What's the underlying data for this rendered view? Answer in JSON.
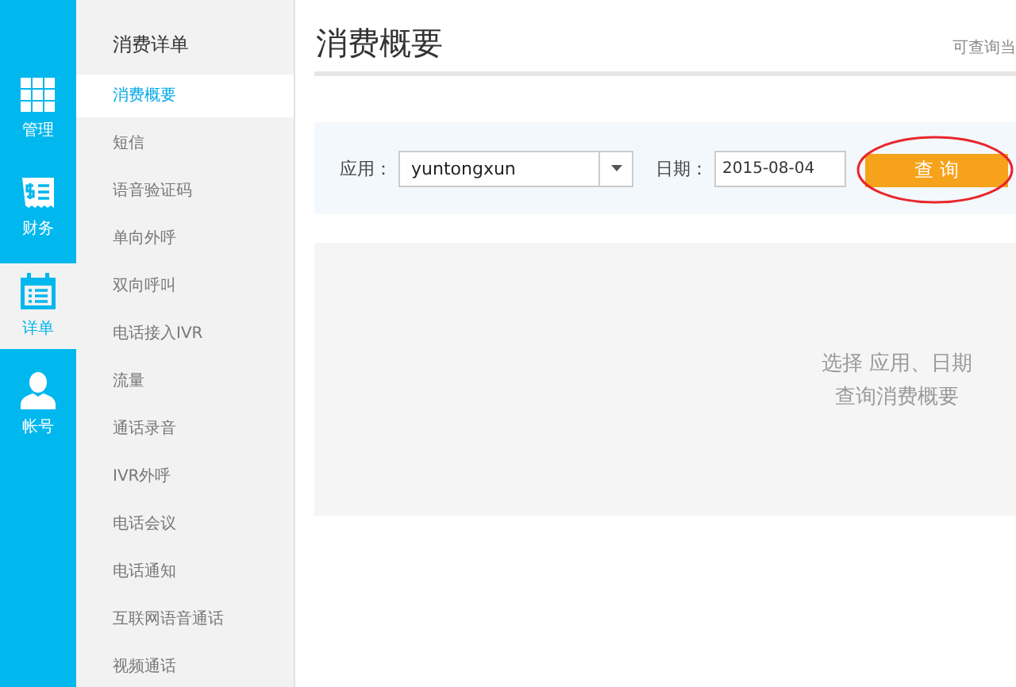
{
  "rail": [
    {
      "label": "管理",
      "kind": "grid",
      "selected": false
    },
    {
      "label": "财务",
      "kind": "bill",
      "selected": false
    },
    {
      "label": "详单",
      "kind": "calendar",
      "selected": true
    },
    {
      "label": "帐号",
      "kind": "user",
      "selected": false
    }
  ],
  "sidebar": {
    "title": "消费详单",
    "items": [
      {
        "label": "消费概要",
        "selected": true
      },
      {
        "label": "短信",
        "selected": false
      },
      {
        "label": "语音验证码",
        "selected": false
      },
      {
        "label": "单向外呼",
        "selected": false
      },
      {
        "label": "双向呼叫",
        "selected": false
      },
      {
        "label": "电话接入IVR",
        "selected": false
      },
      {
        "label": "流量",
        "selected": false
      },
      {
        "label": "通话录音",
        "selected": false
      },
      {
        "label": "IVR外呼",
        "selected": false
      },
      {
        "label": "电话会议",
        "selected": false
      },
      {
        "label": "电话通知",
        "selected": false
      },
      {
        "label": "互联网语音通话",
        "selected": false
      },
      {
        "label": "视频通话",
        "selected": false
      }
    ]
  },
  "page": {
    "title": "消费概要",
    "note": "可查询当"
  },
  "filter": {
    "app_label": "应用：",
    "app_value": "yuntongxun",
    "date_label": "日期：",
    "date_value": "2015-08-04",
    "query_button": "查 询",
    "button_circled": true
  },
  "empty_state": {
    "line_1": "选择 应用、日期",
    "line_2": "查询消费概要"
  }
}
